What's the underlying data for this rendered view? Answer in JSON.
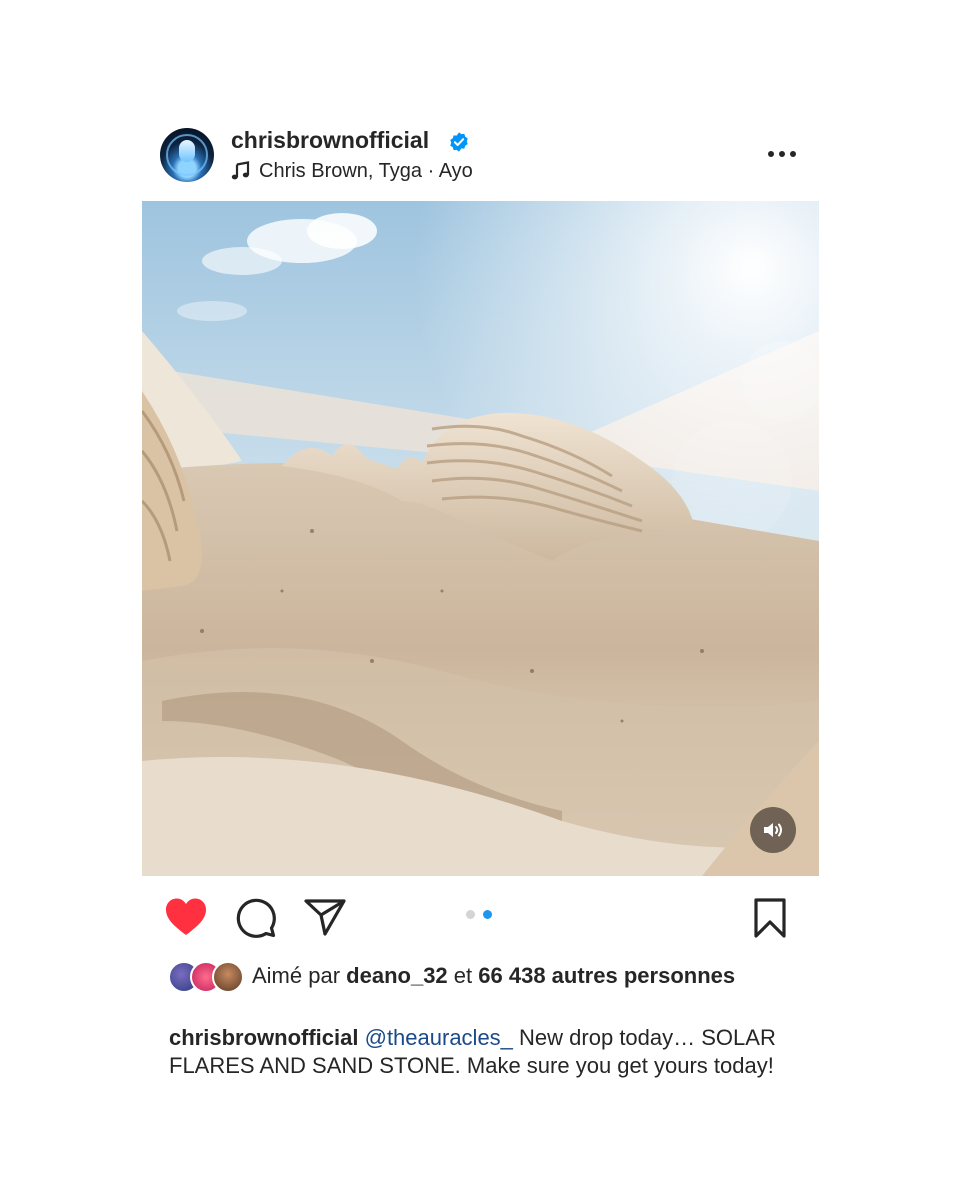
{
  "post": {
    "username": "chrisbrownofficial",
    "verified": true,
    "music": "Chris Brown, Tyga · Ayo",
    "carousel": {
      "count": 2,
      "active_index": 1
    }
  },
  "icons": {
    "avatar": "profile-avatar",
    "verified": "verified-badge-icon",
    "music": "music-note-icon",
    "more": "more-options-icon",
    "sound": "speaker-icon",
    "like": "heart-icon",
    "comment": "comment-icon",
    "share": "share-icon",
    "save": "bookmark-icon"
  },
  "likes": {
    "prefix": "Aimé par",
    "user": "deano_32",
    "middle": "et",
    "count": "66 438 autres",
    "suffix": "personnes"
  },
  "caption": {
    "username": "chrisbrownofficial",
    "mention": "@theauracles_",
    "text": "New drop today… SOLAR FLARES AND SAND STONE.  Make sure you get yours today!"
  },
  "colors": {
    "like_red": "#ff3040",
    "verified_blue": "#0095f6",
    "dot_active": "#1e96f0",
    "mention_blue": "#1a4a8a"
  }
}
